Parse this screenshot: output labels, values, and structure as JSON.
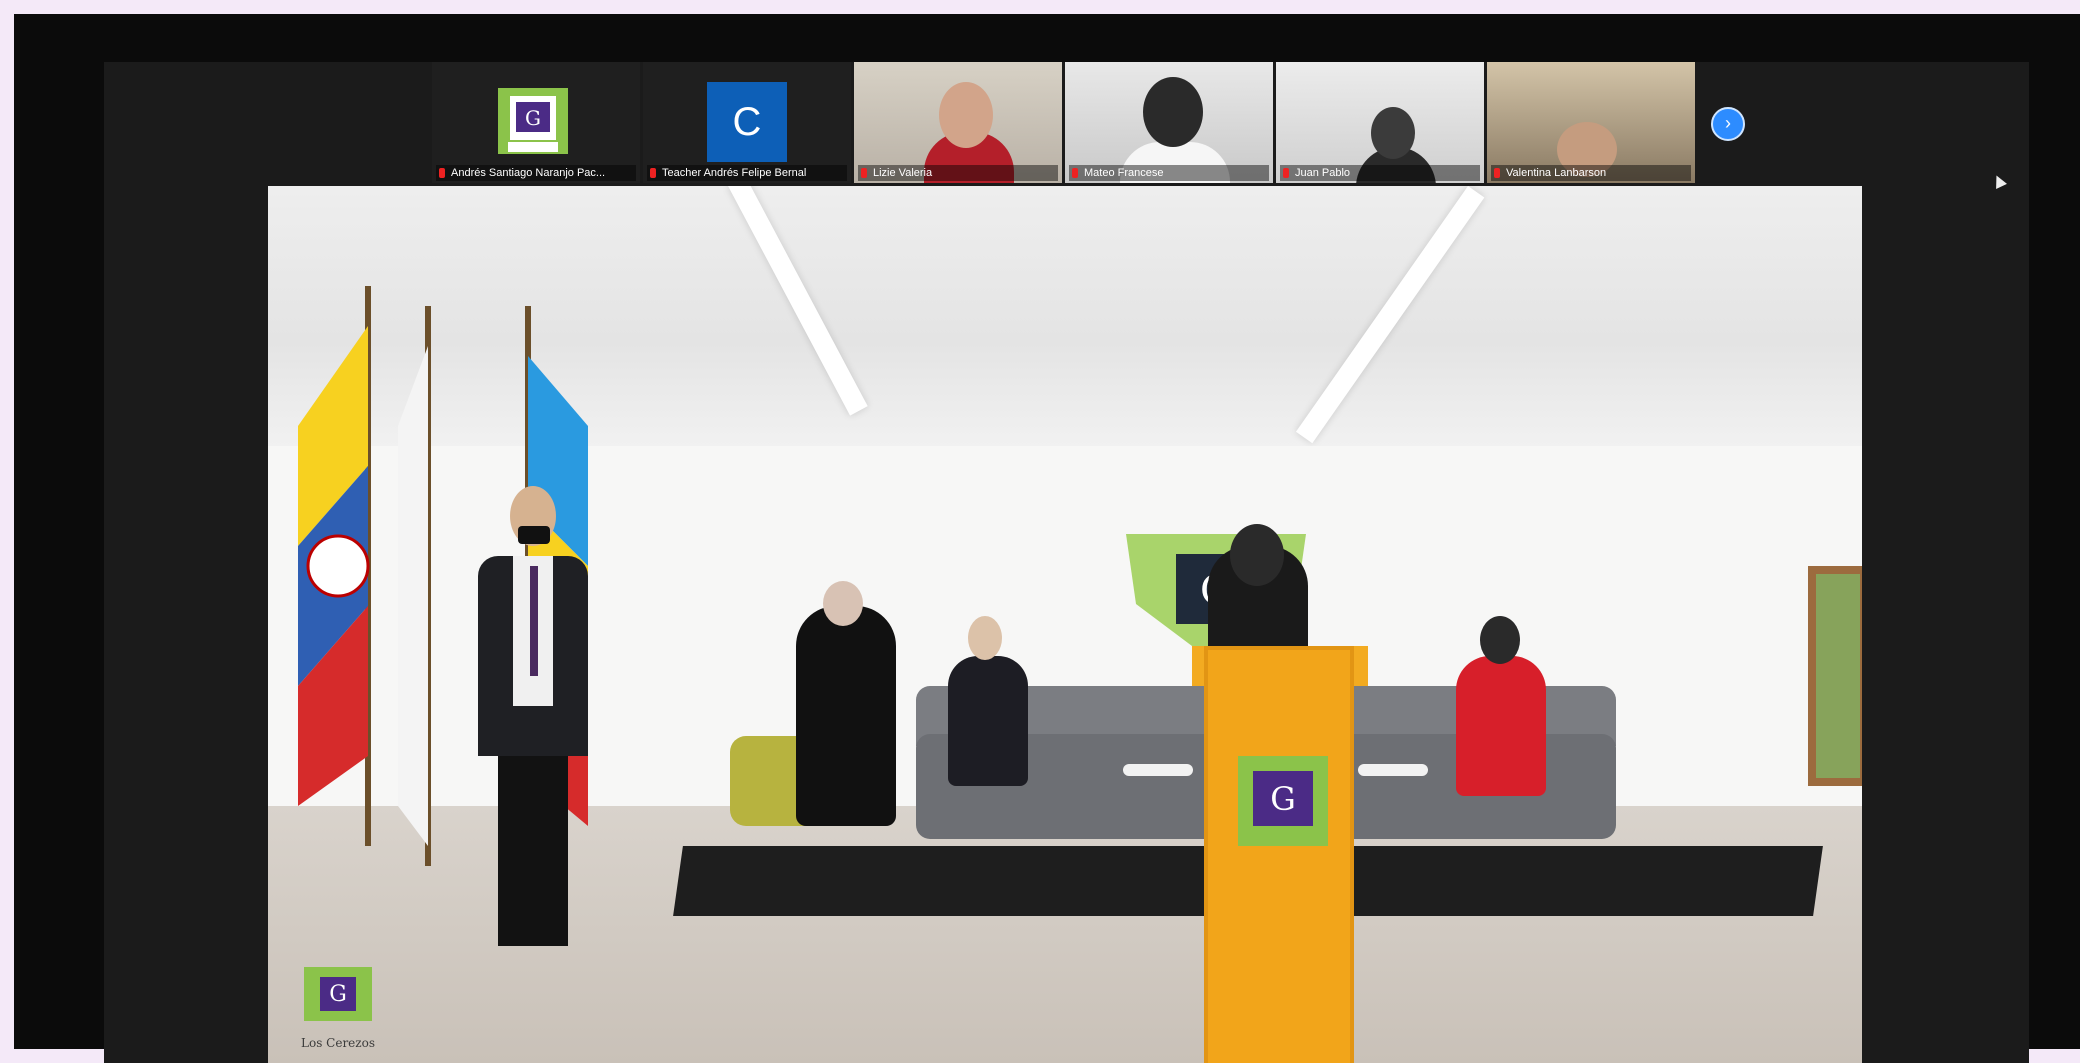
{
  "participants": [
    {
      "name": "Andrés Santiago Naranjo Pac...",
      "type": "logo",
      "logo_text": "Los Cerezos"
    },
    {
      "name": "Teacher Andrés Felipe Bernal",
      "type": "initial",
      "initial": "C"
    },
    {
      "name": "Lizie Valeria",
      "type": "camera"
    },
    {
      "name": "Mateo Francese",
      "type": "camera"
    },
    {
      "name": "Juan Pablo",
      "type": "camera"
    },
    {
      "name": "Valentina Lanbarson",
      "type": "camera"
    }
  ],
  "next_button_icon": "chevron-right-icon",
  "main_video": {
    "description_elements": [
      "flags",
      "speaker at podium",
      "sofa",
      "stage"
    ],
    "corner_logo_text": "Los Cerezos"
  },
  "colors": {
    "zoom_bg": "#1b1b1b",
    "accent_blue": "#2d8cff",
    "podium_yellow": "#f2a51a",
    "initial_tile_blue": "#0d5fb7"
  }
}
